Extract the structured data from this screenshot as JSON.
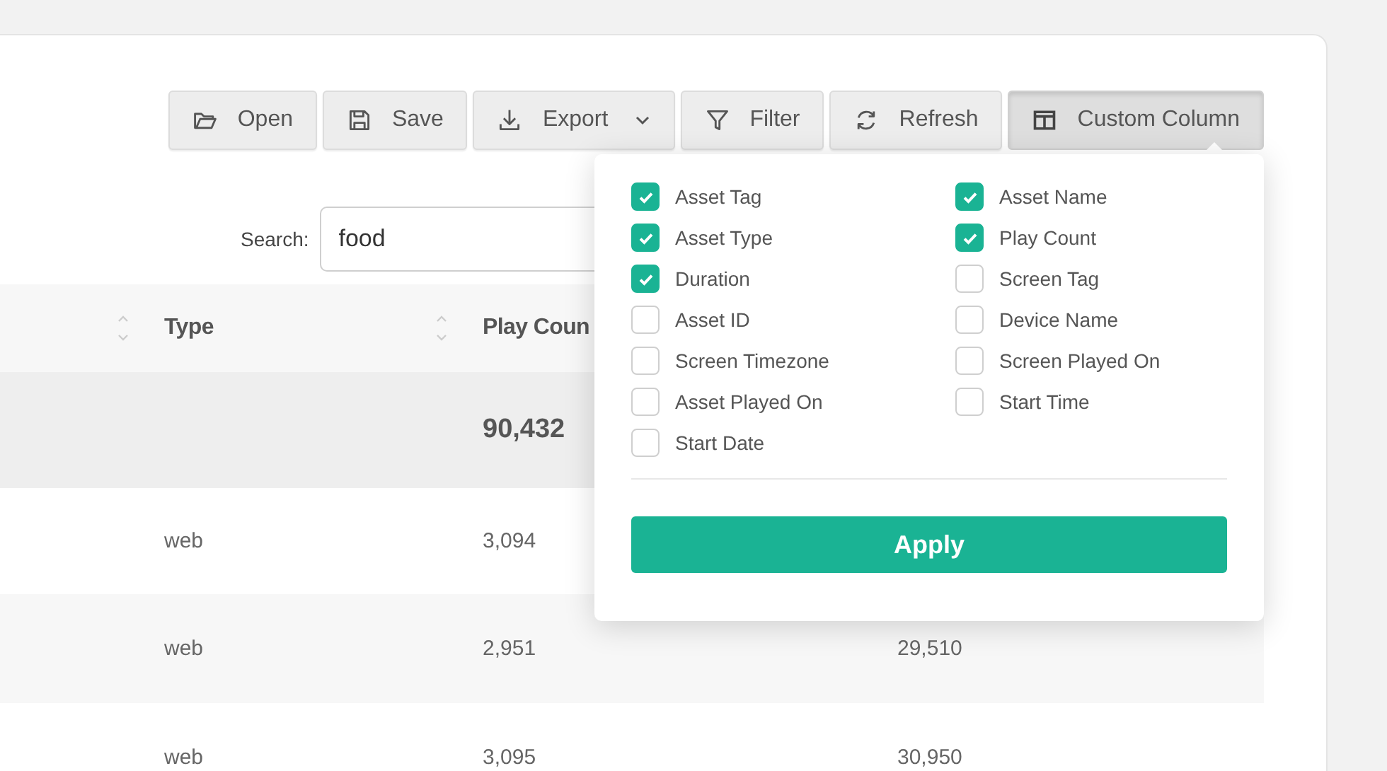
{
  "toolbar": [
    {
      "label": "Open",
      "active": false,
      "dropdown": false
    },
    {
      "label": "Save",
      "active": false,
      "dropdown": false
    },
    {
      "label": "Export",
      "active": false,
      "dropdown": true
    },
    {
      "label": "Filter",
      "active": false,
      "dropdown": false
    },
    {
      "label": "Refresh",
      "active": false,
      "dropdown": false
    },
    {
      "label": "Custom Column",
      "active": true,
      "dropdown": false
    }
  ],
  "search": {
    "label": "Search:",
    "value": "food"
  },
  "table": {
    "columns": [
      {
        "sortable": true
      },
      {
        "label": "Type",
        "sortable": true
      },
      {
        "label": "Play Coun",
        "sortable": false
      },
      {}
    ],
    "total_row": {
      "cells": [
        null,
        null,
        "90,432",
        null
      ]
    },
    "rows": [
      {
        "cells": [
          null,
          "web",
          "3,094",
          null
        ]
      },
      {
        "cells": [
          null,
          "web",
          "2,951",
          "29,510"
        ]
      },
      {
        "cells": [
          null,
          "web",
          "3,095",
          "30,950"
        ]
      }
    ]
  },
  "column_picker": {
    "options": [
      {
        "label": "Asset Tag",
        "checked": true
      },
      {
        "label": "Asset Name",
        "checked": true
      },
      {
        "label": "Asset Type",
        "checked": true
      },
      {
        "label": "Play Count",
        "checked": true
      },
      {
        "label": "Duration",
        "checked": true
      },
      {
        "label": "Screen Tag",
        "checked": false
      },
      {
        "label": "Asset ID",
        "checked": false
      },
      {
        "label": "Device Name",
        "checked": false
      },
      {
        "label": "Screen Timezone",
        "checked": false
      },
      {
        "label": "Screen Played On",
        "checked": false
      },
      {
        "label": "Asset Played On",
        "checked": false
      },
      {
        "label": "Start Time",
        "checked": false
      },
      {
        "label": "Start Date",
        "checked": false
      }
    ],
    "apply_label": "Apply"
  }
}
